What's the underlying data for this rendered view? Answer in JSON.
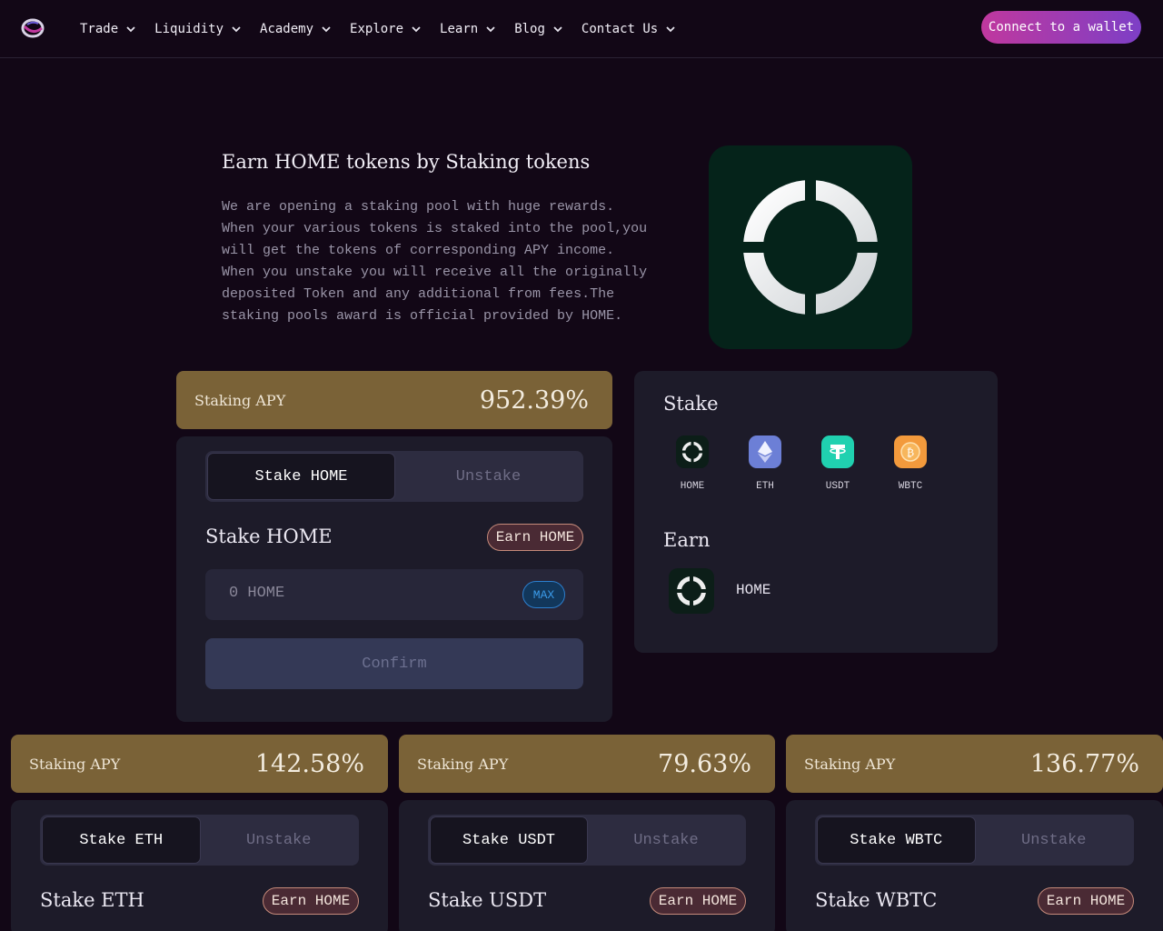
{
  "nav": {
    "items": [
      {
        "label": "Trade"
      },
      {
        "label": "Liquidity"
      },
      {
        "label": "Academy"
      },
      {
        "label": "Explore"
      },
      {
        "label": "Learn"
      },
      {
        "label": "Blog"
      },
      {
        "label": "Contact Us"
      }
    ],
    "connect_label": "Connect to a wallet"
  },
  "hero": {
    "title": "Earn HOME tokens by Staking tokens",
    "description": "We are opening a staking pool with huge rewards. When your various tokens is staked into the pool,you will get the tokens of corresponding APY income. When you unstake you will receive all the originally deposited Token and any additional from fees.The staking pools award is official provided by HOME."
  },
  "main_pool": {
    "apy_label": "Staking APY",
    "apy_value": "952.39%",
    "tab_stake": "Stake HOME",
    "tab_unstake": "Unstake",
    "title": "Stake HOME",
    "earn_badge": "Earn HOME",
    "amount_placeholder": "0 HOME",
    "max_label": "MAX",
    "confirm_label": "Confirm"
  },
  "info": {
    "stake_heading": "Stake",
    "tokens": [
      {
        "name": "HOME",
        "color": "#0c1e18"
      },
      {
        "name": "ETH",
        "color": "#6c7fd6"
      },
      {
        "name": "USDT",
        "color": "#20d1b0"
      },
      {
        "name": "WBTC",
        "color": "#f39a3c"
      }
    ],
    "earn_heading": "Earn",
    "earn_token": "HOME"
  },
  "pools": [
    {
      "apy_label": "Staking APY",
      "apy_value": "142.58%",
      "tab_stake": "Stake ETH",
      "tab_unstake": "Unstake",
      "title": "Stake ETH",
      "earn_badge": "Earn HOME"
    },
    {
      "apy_label": "Staking APY",
      "apy_value": "79.63%",
      "tab_stake": "Stake USDT",
      "tab_unstake": "Unstake",
      "title": "Stake USDT",
      "earn_badge": "Earn HOME"
    },
    {
      "apy_label": "Staking APY",
      "apy_value": "136.77%",
      "tab_stake": "Stake WBTC",
      "tab_unstake": "Unstake",
      "title": "Stake WBTC",
      "earn_badge": "Earn HOME"
    }
  ],
  "colors": {
    "background": "#120716",
    "apy_bar": "#7a6237",
    "panel": "#1d1b29",
    "accent_gradient_start": "#c0389e",
    "accent_gradient_end": "#7d3fc6"
  }
}
